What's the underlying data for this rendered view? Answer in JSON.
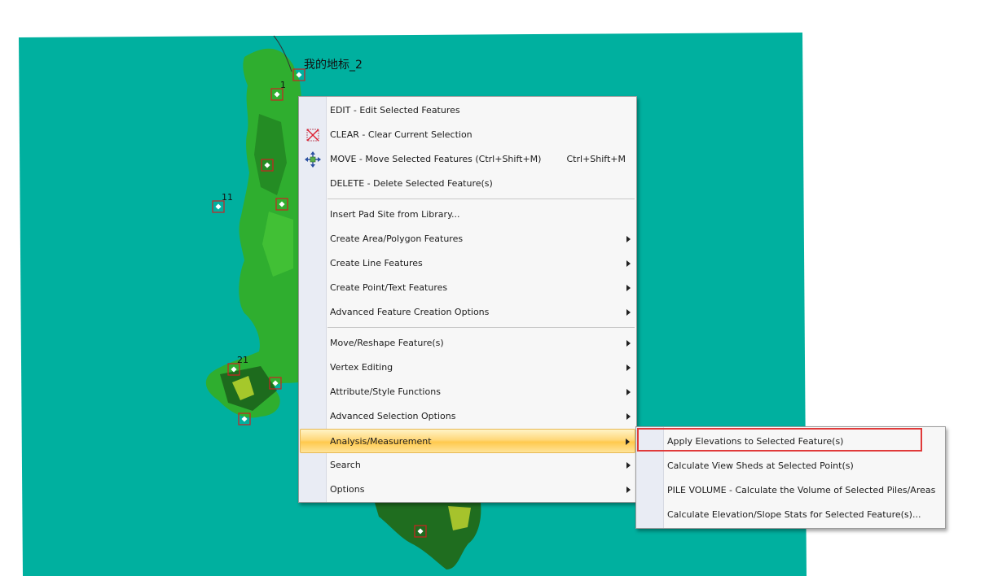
{
  "map": {
    "feature_label": "我的地标_2",
    "point_labels": [
      "1",
      "11",
      "21"
    ],
    "background_color": "#00b09f"
  },
  "context_menu": {
    "items": [
      {
        "label": "EDIT - Edit Selected Features",
        "icon": "none",
        "submenu": false
      },
      {
        "label": "CLEAR - Clear Current Selection",
        "icon": "clear-selection-icon",
        "submenu": false
      },
      {
        "label": "MOVE - Move Selected Features (Ctrl+Shift+M)",
        "shortcut": "Ctrl+Shift+M",
        "icon": "move-arrows-icon",
        "submenu": false
      },
      {
        "label": "DELETE - Delete Selected Feature(s)",
        "icon": "none",
        "submenu": false
      },
      {
        "label": "Insert Pad Site from Library...",
        "submenu": false
      },
      {
        "label": "Create Area/Polygon Features",
        "submenu": true
      },
      {
        "label": "Create Line Features",
        "submenu": true
      },
      {
        "label": "Create Point/Text Features",
        "submenu": true
      },
      {
        "label": "Advanced Feature Creation Options",
        "submenu": true
      },
      {
        "label": "Move/Reshape Feature(s)",
        "submenu": true
      },
      {
        "label": "Vertex Editing",
        "submenu": true
      },
      {
        "label": "Attribute/Style Functions",
        "submenu": true
      },
      {
        "label": "Advanced Selection Options",
        "submenu": true
      },
      {
        "label": "Analysis/Measurement",
        "submenu": true,
        "highlighted": true
      },
      {
        "label": "Search",
        "submenu": true
      },
      {
        "label": "Options",
        "submenu": true
      }
    ]
  },
  "submenu": {
    "items": [
      {
        "label": "Apply Elevations to Selected Feature(s)",
        "emphasized": true
      },
      {
        "label": "Calculate View Sheds at Selected Point(s)"
      },
      {
        "label": "PILE VOLUME - Calculate the Volume of Selected Piles/Areas"
      },
      {
        "label": "Calculate Elevation/Slope Stats for Selected Feature(s)..."
      }
    ]
  },
  "colors": {
    "highlight_box": "#e03a3a",
    "menu_highlight": "#ffd87a",
    "terrain_green": "#2fae2f"
  }
}
